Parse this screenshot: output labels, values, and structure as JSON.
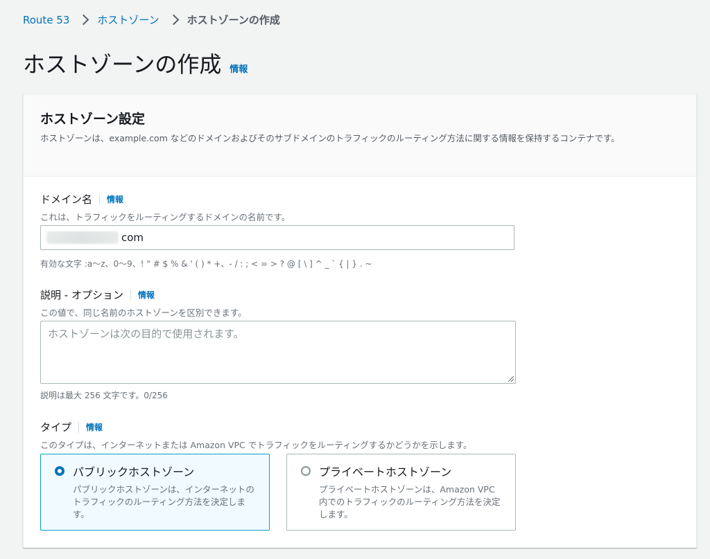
{
  "breadcrumb": {
    "items": [
      "Route 53",
      "ホストゾーン"
    ],
    "current": "ホストゾーンの作成"
  },
  "page": {
    "title": "ホストゾーンの作成",
    "info": "情報"
  },
  "panel": {
    "title": "ホストゾーン設定",
    "description": "ホストゾーンは、example.com などのドメインおよびそのサブドメインのトラフィックのルーティング方法に関する情報を保持するコンテナです。"
  },
  "domain": {
    "label": "ドメイン名",
    "info": "情報",
    "description": "これは、トラフィックをルーティングするドメインの名前です。",
    "value": "com",
    "hint": "有効な文字 :a～z、0～9、! \" # $ % & ' ( ) * +、- / : ; < = > ? @ [ \\ ] ^ _ ` { | } . ~"
  },
  "comment": {
    "label": "説明 - オプション",
    "info": "情報",
    "description": "この値で、同じ名前のホストゾーンを区別できます。",
    "placeholder": "ホストゾーンは次の目的で使用されます。",
    "counter": "説明は最大 256 文字です。0/256"
  },
  "type": {
    "label": "タイプ",
    "info": "情報",
    "description": "このタイプは、インターネットまたは Amazon VPC でトラフィックをルーティングするかどうかを示します。",
    "options": [
      {
        "label": "パブリックホストゾーン",
        "description": "パブリックホストゾーンは、インターネットのトラフィックのルーティング方法を決定します。",
        "selected": true
      },
      {
        "label": "プライベートホストゾーン",
        "description": "プライベートホストゾーンは、Amazon VPC 内でのトラフィックのルーティング方法を決定します。",
        "selected": false
      }
    ]
  },
  "colors": {
    "accent": "#0073bb",
    "selected_border": "#00a1c9",
    "selected_bg": "#f1faff"
  }
}
